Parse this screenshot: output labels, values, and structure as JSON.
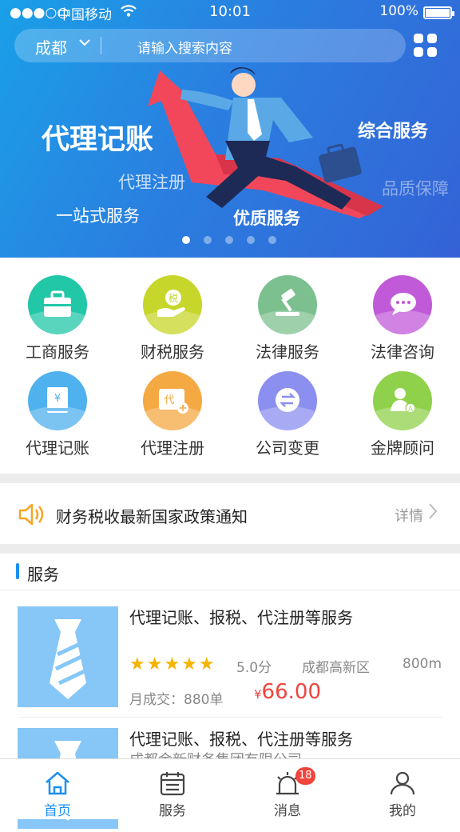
{
  "status": {
    "carrier": "中国移动",
    "time": "10:01",
    "battery": "100%"
  },
  "search": {
    "city": "成都",
    "placeholder": "请输入搜索内容"
  },
  "banner": {
    "texts": [
      "代理记账",
      "代理注册",
      "一站式服务",
      "综合服务",
      "品质保障",
      "优质服务"
    ],
    "slide_count": 5,
    "active_slide": 1
  },
  "categories": [
    {
      "label": "工商服务",
      "icon": "briefcase-icon",
      "color": "#22c7a8"
    },
    {
      "label": "财税服务",
      "icon": "tax-hand-icon",
      "color": "#c7d62a"
    },
    {
      "label": "法律服务",
      "icon": "gavel-icon",
      "color": "#7cc08f"
    },
    {
      "label": "法律咨询",
      "icon": "chat-bubble-icon",
      "color": "#c05ad8"
    },
    {
      "label": "代理记账",
      "icon": "ledger-book-icon",
      "color": "#4fb1ee"
    },
    {
      "label": "代理注册",
      "icon": "register-card-icon",
      "color": "#f5a942"
    },
    {
      "label": "公司变更",
      "icon": "swap-arrows-icon",
      "color": "#8b8ff0"
    },
    {
      "label": "金牌顾问",
      "icon": "advisor-icon",
      "color": "#8fd14a"
    }
  ],
  "notice": {
    "text": "财务税收最新国家政策通知",
    "more": "详情"
  },
  "section": {
    "title": "服务"
  },
  "services": [
    {
      "title": "代理记账、报税、代注册等服务",
      "rating": "5.0分",
      "stars": 5,
      "location": "成都高新区",
      "distance": "800m",
      "sold": "月成交：880单",
      "currency": "¥",
      "price": "66.00"
    },
    {
      "title": "代理记账、报税、代注册等服务",
      "subtitle": "成都金新财务集团有限公司"
    }
  ],
  "tabs": [
    {
      "label": "首页",
      "icon": "home-icon",
      "active": true
    },
    {
      "label": "服务",
      "icon": "calendar-icon"
    },
    {
      "label": "消息",
      "icon": "alarm-bell-icon",
      "badge": "18"
    },
    {
      "label": "我的",
      "icon": "user-icon"
    }
  ],
  "colors": {
    "primary": "#1d8ff0",
    "price": "#f0443c",
    "star": "#f5b400"
  }
}
